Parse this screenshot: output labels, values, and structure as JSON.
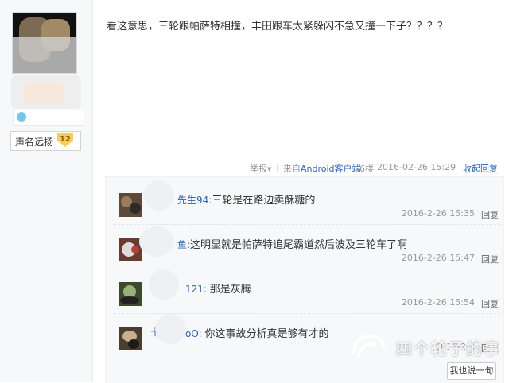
{
  "author": {
    "fame_label": "声名远扬",
    "fame_level": "12"
  },
  "post": {
    "text": "看这意思，三轮跟帕萨特相撞，丰田跟车太紧躲闪不急又撞一下子？？？？",
    "report_label": "举报",
    "separator": "|",
    "source": "来自Android客户端",
    "floor": "6楼",
    "date": "2016-02-26 15:29",
    "collapse_label": "收起回复"
  },
  "replies": [
    {
      "user": "先生94:",
      "text": "三轮是在路边卖酥糖的",
      "time": "2016-2-26 15:35",
      "reply_label": "回复"
    },
    {
      "user": "鱼:",
      "text": "这明显就是帕萨特追尾霸道然后波及三轮车了啊",
      "time": "2016-2-26 15:47",
      "reply_label": "回复"
    },
    {
      "user": "121:",
      "text": "那是灰腾",
      "time": "2016-2-26 15:54",
      "reply_label": "回复"
    },
    {
      "user": "十",
      "user2": "oO:",
      "text": "你这事故分析真是够有才的",
      "time": "2016-2-2",
      "reply_label": "回复"
    }
  ],
  "watermark_text": "四个轮子的事",
  "say_button_label": "我也说一句"
}
